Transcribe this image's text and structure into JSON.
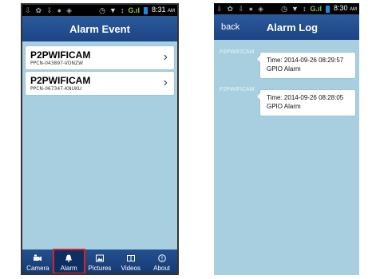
{
  "left_screen": {
    "status": {
      "time": "8:31",
      "ampm": "AM"
    },
    "title": "Alarm Event",
    "devices": [
      {
        "name": "P2PWIFICAM",
        "uid": "PPCN-043897-VDNZW"
      },
      {
        "name": "P2PWIFICAM",
        "uid": "PPCN-067347-KNUKU"
      }
    ],
    "tabs": [
      {
        "label": "Camera",
        "icon": "camera-icon"
      },
      {
        "label": "Alarm",
        "icon": "bell-icon",
        "active": true
      },
      {
        "label": "Pictures",
        "icon": "picture-icon"
      },
      {
        "label": "Videos",
        "icon": "video-icon"
      },
      {
        "label": "About",
        "icon": "info-icon"
      }
    ]
  },
  "right_screen": {
    "status": {
      "time": "8:30",
      "ampm": "AM"
    },
    "back_label": "back",
    "title": "Alarm Log",
    "logs": [
      {
        "device": "P2PWIFICAM",
        "time": "Time: 2014-09-26 08:29:57",
        "type": "GPIO Alarm"
      },
      {
        "device": "P2PWIFICAM",
        "time": "Time: 2014-09-26 08:28:05",
        "type": "GPIO Alarm"
      }
    ]
  },
  "colors": {
    "background": "#a8cfe0",
    "bar": "#1c4484",
    "highlight": "#e02020"
  }
}
